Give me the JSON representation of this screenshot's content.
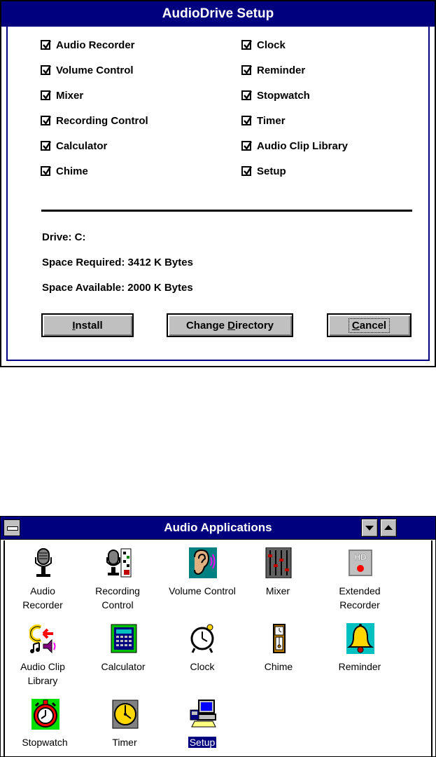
{
  "dialog": {
    "title": "AudioDrive Setup",
    "checkboxes_left": [
      {
        "label": "Audio Recorder",
        "checked": true
      },
      {
        "label": "Volume Control",
        "checked": true
      },
      {
        "label": "Mixer",
        "checked": true
      },
      {
        "label": "Recording Control",
        "checked": true
      },
      {
        "label": "Calculator",
        "checked": true
      },
      {
        "label": "Chime",
        "checked": true
      }
    ],
    "checkboxes_right": [
      {
        "label": "Clock",
        "checked": true
      },
      {
        "label": "Reminder",
        "checked": true
      },
      {
        "label": "Stopwatch",
        "checked": true
      },
      {
        "label": "Timer",
        "checked": true
      },
      {
        "label": "Audio Clip Library",
        "checked": true
      },
      {
        "label": "Setup",
        "checked": true
      }
    ],
    "drive": "Drive: C:",
    "space_required": "Space Required: 3412 K Bytes",
    "space_available": "Space Available: 2000 K Bytes",
    "buttons": {
      "install": {
        "pre": "",
        "acc": "I",
        "post": "nstall"
      },
      "change_directory": {
        "pre": "Change ",
        "acc": "D",
        "post": "irectory"
      },
      "cancel": {
        "pre": "",
        "acc": "C",
        "post": "ancel"
      }
    }
  },
  "group_window": {
    "title": "Audio Applications",
    "apps": [
      {
        "line1": "Audio",
        "line2": "Recorder",
        "icon": "microphone-icon"
      },
      {
        "line1": "Recording",
        "line2": "Control",
        "icon": "recording-control-icon"
      },
      {
        "line1": "Volume Control",
        "line2": "",
        "icon": "ear-speaker-icon"
      },
      {
        "line1": "Mixer",
        "line2": "",
        "icon": "mixer-sliders-icon"
      },
      {
        "line1": "Extended",
        "line2": "Recorder",
        "icon": "hd-recorder-icon"
      },
      {
        "line1": "Audio Clip",
        "line2": "Library",
        "icon": "audio-clip-icon"
      },
      {
        "line1": "Calculator",
        "line2": "",
        "icon": "calculator-icon"
      },
      {
        "line1": "Clock",
        "line2": "",
        "icon": "alarm-clock-icon"
      },
      {
        "line1": "Chime",
        "line2": "",
        "icon": "grandfather-clock-icon"
      },
      {
        "line1": "Reminder",
        "line2": "",
        "icon": "bell-icon"
      },
      {
        "line1": "Stopwatch",
        "line2": "",
        "icon": "stopwatch-icon"
      },
      {
        "line1": "Timer",
        "line2": "",
        "icon": "timer-icon"
      },
      {
        "line1": "Setup",
        "line2": "",
        "icon": "computer-setup-icon",
        "selected": true
      }
    ]
  },
  "colors": {
    "title_bar": "#00007f",
    "button_face": "#c0c0c0"
  }
}
